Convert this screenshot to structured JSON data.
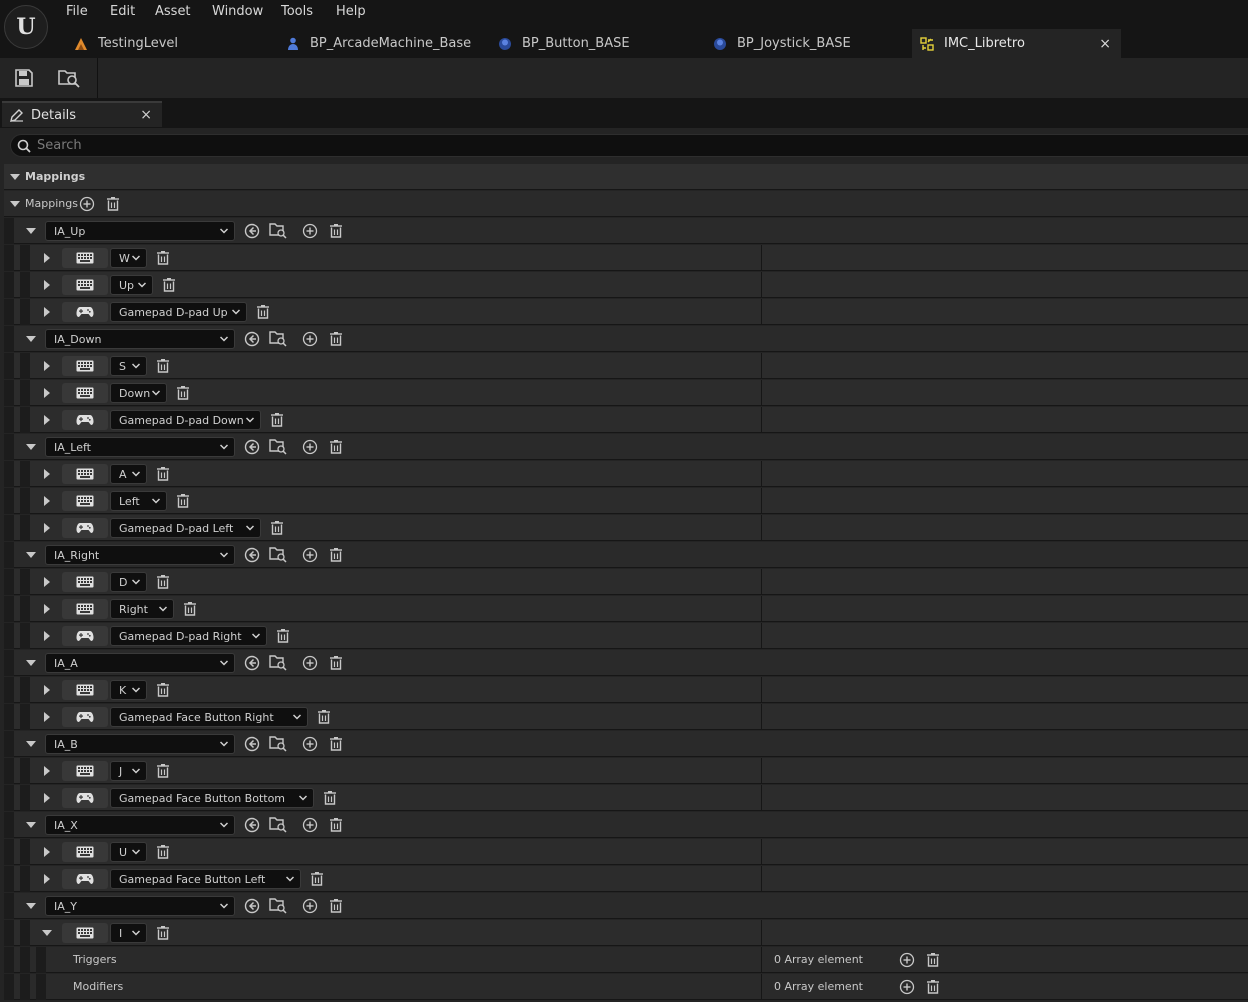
{
  "menu": [
    "File",
    "Edit",
    "Asset",
    "Window",
    "Tools",
    "Help"
  ],
  "tabs": [
    {
      "label": "TestingLevel",
      "icon": "level-icon"
    },
    {
      "label": "BP_ArcadeMachine_Base",
      "icon": "blueprint-actor-icon"
    },
    {
      "label": "BP_Button_BASE",
      "icon": "blueprint-icon"
    },
    {
      "label": "BP_Joystick_BASE",
      "icon": "blueprint-icon"
    },
    {
      "label": "IMC_Libretro",
      "icon": "input-mapping-context-icon",
      "active": true
    }
  ],
  "details": {
    "tab_label": "Details",
    "close": "×",
    "search_placeholder": "Search"
  },
  "category_label": "Mappings",
  "mappings_label": "Mappings",
  "actions": [
    {
      "name": "IA_Up",
      "keys": [
        {
          "device": "keyboard",
          "key": "W"
        },
        {
          "device": "keyboard",
          "key": "Up"
        },
        {
          "device": "gamepad",
          "key": "Gamepad D-pad Up"
        }
      ]
    },
    {
      "name": "IA_Down",
      "keys": [
        {
          "device": "keyboard",
          "key": "S"
        },
        {
          "device": "keyboard",
          "key": "Down"
        },
        {
          "device": "gamepad",
          "key": "Gamepad D-pad Down"
        }
      ]
    },
    {
      "name": "IA_Left",
      "keys": [
        {
          "device": "keyboard",
          "key": "A"
        },
        {
          "device": "keyboard",
          "key": "Left"
        },
        {
          "device": "gamepad",
          "key": "Gamepad D-pad Left"
        }
      ]
    },
    {
      "name": "IA_Right",
      "keys": [
        {
          "device": "keyboard",
          "key": "D"
        },
        {
          "device": "keyboard",
          "key": "Right"
        },
        {
          "device": "gamepad",
          "key": "Gamepad D-pad Right"
        }
      ]
    },
    {
      "name": "IA_A",
      "keys": [
        {
          "device": "keyboard",
          "key": "K"
        },
        {
          "device": "gamepad",
          "key": "Gamepad Face Button Right"
        }
      ]
    },
    {
      "name": "IA_B",
      "keys": [
        {
          "device": "keyboard",
          "key": "J"
        },
        {
          "device": "gamepad",
          "key": "Gamepad Face Button Bottom"
        }
      ]
    },
    {
      "name": "IA_X",
      "keys": [
        {
          "device": "keyboard",
          "key": "U"
        },
        {
          "device": "gamepad",
          "key": "Gamepad Face Button Left"
        }
      ]
    },
    {
      "name": "IA_Y",
      "keys": [
        {
          "device": "keyboard",
          "key": "I",
          "expanded": true
        }
      ]
    }
  ],
  "expanded_props": [
    {
      "label": "Triggers",
      "value": "0 Array element"
    },
    {
      "label": "Modifiers",
      "value": "0 Array element"
    }
  ]
}
